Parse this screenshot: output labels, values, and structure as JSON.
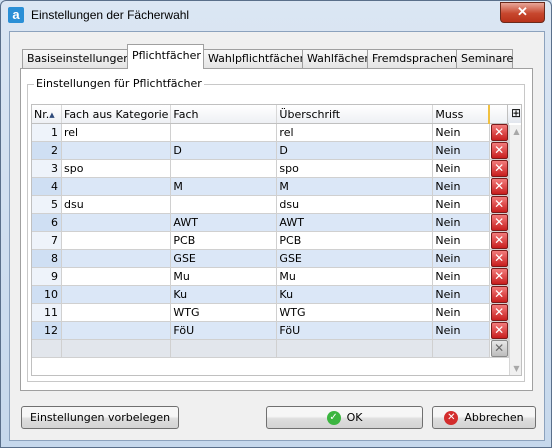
{
  "window": {
    "title": "Einstellungen der Fächerwahl",
    "app_icon_letter": "a"
  },
  "tabs": [
    {
      "label": "Basiseinstellungen"
    },
    {
      "label": "Pflichtfächer"
    },
    {
      "label": "Wahlpflichtfächer"
    },
    {
      "label": "Wahlfächer"
    },
    {
      "label": "Fremdsprachen"
    },
    {
      "label": "Seminare"
    }
  ],
  "group": {
    "label": "Einstellungen für Pflichtfächer"
  },
  "grid": {
    "headers": {
      "nr": "Nr.",
      "kategorie": "Fach aus Kategorie",
      "fach": "Fach",
      "ueberschrift": "Überschrift",
      "muss": "Muss"
    },
    "sort_indicator": "▲",
    "rows": [
      {
        "nr": "1",
        "kategorie": "rel",
        "fach": "",
        "ueberschrift": "rel",
        "muss": "Nein"
      },
      {
        "nr": "2",
        "kategorie": "",
        "fach": "D",
        "ueberschrift": "D",
        "muss": "Nein"
      },
      {
        "nr": "3",
        "kategorie": "spo",
        "fach": "",
        "ueberschrift": "spo",
        "muss": "Nein"
      },
      {
        "nr": "4",
        "kategorie": "",
        "fach": "M",
        "ueberschrift": "M",
        "muss": "Nein"
      },
      {
        "nr": "5",
        "kategorie": "dsu",
        "fach": "",
        "ueberschrift": "dsu",
        "muss": "Nein"
      },
      {
        "nr": "6",
        "kategorie": "",
        "fach": "AWT",
        "ueberschrift": "AWT",
        "muss": "Nein"
      },
      {
        "nr": "7",
        "kategorie": "",
        "fach": "PCB",
        "ueberschrift": "PCB",
        "muss": "Nein"
      },
      {
        "nr": "8",
        "kategorie": "",
        "fach": "GSE",
        "ueberschrift": "GSE",
        "muss": "Nein"
      },
      {
        "nr": "9",
        "kategorie": "",
        "fach": "Mu",
        "ueberschrift": "Mu",
        "muss": "Nein"
      },
      {
        "nr": "10",
        "kategorie": "",
        "fach": "Ku",
        "ueberschrift": "Ku",
        "muss": "Nein"
      },
      {
        "nr": "11",
        "kategorie": "",
        "fach": "WTG",
        "ueberschrift": "WTG",
        "muss": "Nein"
      },
      {
        "nr": "12",
        "kategorie": "",
        "fach": "FöU",
        "ueberschrift": "FöU",
        "muss": "Nein"
      }
    ]
  },
  "buttons": {
    "defaults": "Einstellungen vorbelegen",
    "ok": "OK",
    "cancel": "Abbrechen"
  },
  "icons": {
    "delete": "delete-x-icon",
    "ok": "check-icon",
    "cancel": "cancel-icon",
    "column_menu": "column-chooser-icon"
  },
  "colors": {
    "alt_row": "#dbe7f7",
    "delete_red": "#c81e1e",
    "ok_green": "#3bb540"
  }
}
